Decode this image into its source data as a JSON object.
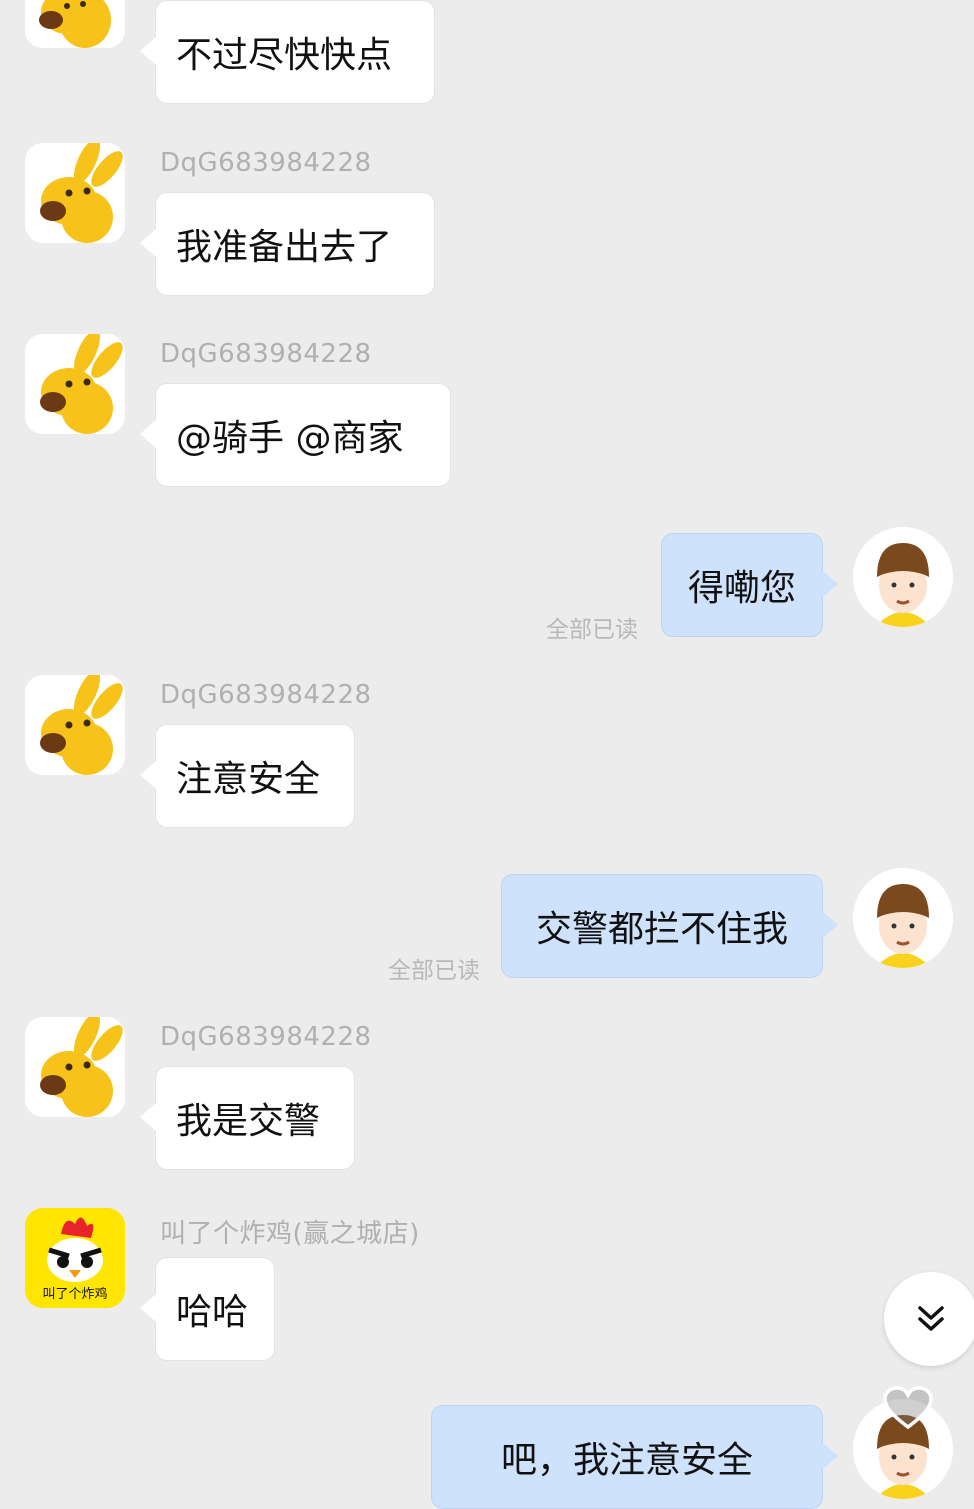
{
  "messages": [
    {
      "id": "m0",
      "side": "in",
      "avatar": "kangaroo-avatar",
      "sender": "",
      "text": "不过尽快快点"
    },
    {
      "id": "m1",
      "side": "in",
      "avatar": "kangaroo-avatar",
      "sender": "DqG683984228",
      "text": "我准备出去了"
    },
    {
      "id": "m2",
      "side": "in",
      "avatar": "kangaroo-avatar",
      "sender": "DqG683984228",
      "text": "@骑手 @商家"
    },
    {
      "id": "m3",
      "side": "out",
      "avatar": "rider-avatar",
      "text": "得嘞您",
      "status": "全部已读"
    },
    {
      "id": "m4",
      "side": "in",
      "avatar": "kangaroo-avatar",
      "sender": "DqG683984228",
      "text": "注意安全"
    },
    {
      "id": "m5",
      "side": "out",
      "avatar": "rider-avatar",
      "text": "交警都拦不住我",
      "status": "全部已读"
    },
    {
      "id": "m6",
      "side": "in",
      "avatar": "kangaroo-avatar",
      "sender": "DqG683984228",
      "text": "我是交警"
    },
    {
      "id": "m7",
      "side": "in",
      "avatar": "chicken-avatar",
      "sender": "叫了个炸鸡(赢之城店)",
      "text": "哈哈"
    },
    {
      "id": "m8",
      "side": "out",
      "avatar": "rider-avatar",
      "text": "吧，我注意安全"
    }
  ],
  "chicken_logo_text": "叫了个炸鸡",
  "controls": {
    "scroll_down_icon": "double-chevron-down-icon",
    "like_icon": "heart-icon"
  },
  "colors": {
    "background": "#ececec",
    "incoming_bubble": "#ffffff",
    "outgoing_bubble": "#cfe2fb",
    "meta_text": "#b0b0b0"
  }
}
